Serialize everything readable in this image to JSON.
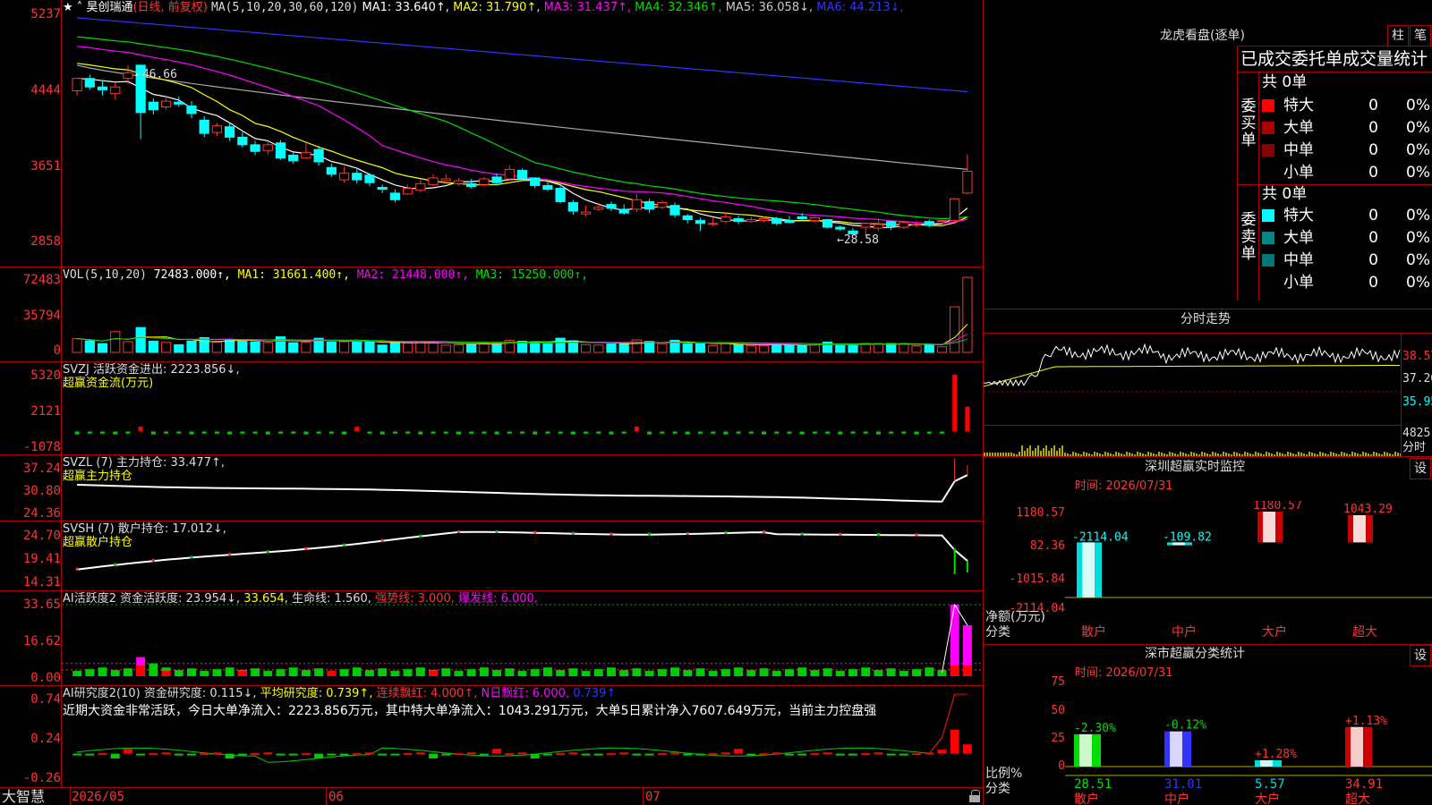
{
  "colors": {
    "up": "#ff3333",
    "down": "#00ffff",
    "bg": "#000000",
    "grid": "#aa0000",
    "white": "#ffffff",
    "yellow": "#ffff00",
    "magenta": "#ff00ff",
    "green": "#00dd00",
    "blue": "#3333ff",
    "gray": "#aaaaaa",
    "cyan": "#00ffff"
  },
  "main": {
    "stock_name": "昊创瑞通",
    "period_note": "(日线, 前复权)",
    "ma_title": "MA(5,10,20,30,60,120)",
    "ma_values": [
      {
        "label": "MA1: 33.640↑",
        "color": "#ffffff"
      },
      {
        "label": "MA2: 31.790↑",
        "color": "#ffff00"
      },
      {
        "label": "MA3: 31.437↑",
        "color": "#ff00ff"
      },
      {
        "label": "MA4: 32.346↑",
        "color": "#00dd00"
      },
      {
        "label": "MA5: 36.058↓",
        "color": "#cccccc"
      },
      {
        "label": "MA6: 44.213↓",
        "color": "#3333ff"
      }
    ],
    "y_ticks": [
      "5237",
      "4444",
      "3651",
      "2858"
    ],
    "high_label": "46.66",
    "low_label": "28.58"
  },
  "volume": {
    "title": "VOL(5,10,20)",
    "values": [
      {
        "label": "72483.000↑",
        "color": "#ffffff"
      },
      {
        "label": "MA1: 31661.400↑",
        "color": "#ffff00"
      },
      {
        "label": "MA2: 21448.000↑",
        "color": "#ff00ff"
      },
      {
        "label": "MA3: 15250.000↑",
        "color": "#00dd00"
      }
    ],
    "y_ticks": [
      "72483",
      "35794",
      "0"
    ]
  },
  "svzj": {
    "title": "SVZJ  活跃资金进出: 2223.856↓,",
    "subtitle": "超赢资金流(万元)",
    "y_ticks": [
      "5320",
      "2121",
      "-1078"
    ]
  },
  "svzl": {
    "title": "SVZL (7) 主力持仓: 33.477↑,",
    "subtitle": "超赢主力持仓",
    "y_ticks": [
      "37.24",
      "30.80",
      "24.36"
    ]
  },
  "svsh": {
    "title": "SVSH (7) 散户持仓: 17.012↓,",
    "subtitle": "超赢散户持仓",
    "y_ticks": [
      "24.70",
      "19.41",
      "14.31"
    ]
  },
  "ai_active": {
    "segments": [
      {
        "text": "AI活跃度2 资金活跃度: 23.954↓, ",
        "color": "#dddddd"
      },
      {
        "text": "33.654, ",
        "color": "#ffff00"
      },
      {
        "text": "生命线: 1.560, ",
        "color": "#dddddd"
      },
      {
        "text": "强势线: 3.000, ",
        "color": "#ff3333"
      },
      {
        "text": "爆发线: 6.000,",
        "color": "#ff00ff"
      }
    ],
    "y_ticks": [
      "33.65",
      "16.62",
      "0.00"
    ]
  },
  "ai_research": {
    "segments": [
      {
        "text": "AI研究度2(10) 资金研究度: 0.115↓, ",
        "color": "#dddddd"
      },
      {
        "text": "平均研究度: 0.739↑, ",
        "color": "#ffff00"
      },
      {
        "text": "连续飘红: 4.000↑, ",
        "color": "#ff3333"
      },
      {
        "text": "N日飘红: 6.000, ",
        "color": "#ff00ff"
      },
      {
        "text": "0.739↑",
        "color": "#3333ff"
      }
    ],
    "summary": "近期大资金非常活跃，今日大单净流入：2223.856万元，其中特大单净流入：1043.291万元，大单5日累计净入7607.649万元，当前主力控盘强",
    "y_ticks": [
      "0.74",
      "0.24",
      "-0.26"
    ]
  },
  "bottom": {
    "brand": "大智慧",
    "dates": [
      "2026/05",
      "06",
      "07"
    ]
  },
  "right": {
    "dragon_title": "龙虎看盘(逐单)",
    "btn_pillar": "柱",
    "btn_stroke": "笔",
    "stats_title": "已成交委托单成交量统计",
    "buy_side": "委买单",
    "sell_side": "委卖单",
    "buy_total": "共 0单",
    "sell_total": "共 0单",
    "buy_rows": [
      {
        "label": "特大",
        "count": "0",
        "pct": "0%",
        "color": "#ff0000"
      },
      {
        "label": "大单",
        "count": "0",
        "pct": "0%",
        "color": "#aa0000"
      },
      {
        "label": "中单",
        "count": "0",
        "pct": "0%",
        "color": "#880000"
      },
      {
        "label": "小单",
        "count": "0",
        "pct": "0%",
        "color": ""
      }
    ],
    "sell_rows": [
      {
        "label": "特大",
        "count": "0",
        "pct": "0%",
        "color": "#00ffff"
      },
      {
        "label": "大单",
        "count": "0",
        "pct": "0%",
        "color": "#008888"
      },
      {
        "label": "中单",
        "count": "0",
        "pct": "0%",
        "color": "#007777"
      },
      {
        "label": "小单",
        "count": "0",
        "pct": "0%",
        "color": ""
      }
    ],
    "intraday_title": "分时走势",
    "intraday_ticks": [
      "38.57",
      "37.26",
      "35.95",
      "4825",
      "分时"
    ],
    "sz_monitor_title": "深圳超赢实时监控",
    "btn_set": "设",
    "time_label": "时间: 2026/07/31",
    "monitor_ticks": [
      "1180.57",
      "82.36",
      "-1015.84",
      "-2114.04"
    ],
    "monitor_net": "净额(万元)",
    "monitor_cat": "分类",
    "monitor_cats": [
      "散户",
      "中户",
      "大户",
      "超大"
    ],
    "monitor_values": [
      "-2114.04",
      "-109.82",
      "1180.57",
      "1043.29"
    ],
    "class_title": "深市超赢分类统计",
    "class_ticks": [
      "75",
      "50",
      "25",
      "0"
    ],
    "class_ratio": "比例%",
    "class_cat": "分类",
    "class_changes": [
      "-2.30%",
      "-0.12%",
      "+1.28%",
      "+1.13%"
    ],
    "class_values": [
      "28.51",
      "31.01",
      "5.57",
      "34.91"
    ],
    "class_cats": [
      "散户",
      "中户",
      "大户",
      "超大"
    ]
  },
  "chart_data": [
    {
      "type": "candlestick",
      "title": "昊创瑞通 (日线, 前复权)",
      "x_start": "2026/05",
      "x_ticks": [
        "2026/05",
        "06",
        "07"
      ],
      "ylim": [
        2858,
        5237
      ],
      "annotations": [
        "46.66",
        "28.58"
      ],
      "candles": [
        [
          4430,
          4560,
          4560,
          4380,
          "u"
        ],
        [
          4560,
          4470,
          4600,
          4440,
          "d"
        ],
        [
          4470,
          4440,
          4540,
          4380,
          "d"
        ],
        [
          4400,
          4470,
          4520,
          4340,
          "u"
        ],
        [
          4560,
          4620,
          4700,
          4500,
          "u"
        ],
        [
          4700,
          4200,
          4700,
          3920,
          "d"
        ],
        [
          4310,
          4230,
          4350,
          4180,
          "d"
        ],
        [
          4260,
          4320,
          4370,
          4230,
          "u"
        ],
        [
          4310,
          4290,
          4370,
          4260,
          "d"
        ],
        [
          4270,
          4190,
          4320,
          4140,
          "d"
        ],
        [
          4120,
          3980,
          4160,
          3940,
          "d"
        ],
        [
          3990,
          4060,
          4090,
          3950,
          "u"
        ],
        [
          4050,
          3940,
          4090,
          3900,
          "d"
        ],
        [
          3940,
          3860,
          3990,
          3830,
          "d"
        ],
        [
          3860,
          3790,
          3900,
          3750,
          "d"
        ],
        [
          3800,
          3860,
          3890,
          3760,
          "u"
        ],
        [
          3880,
          3720,
          3910,
          3700,
          "d"
        ],
        [
          3750,
          3690,
          3780,
          3660,
          "d"
        ],
        [
          3720,
          3780,
          3880,
          3710,
          "u"
        ],
        [
          3810,
          3680,
          3850,
          3640,
          "d"
        ],
        [
          3620,
          3550,
          3660,
          3520,
          "d"
        ],
        [
          3490,
          3560,
          3630,
          3460,
          "u"
        ],
        [
          3560,
          3490,
          3600,
          3450,
          "d"
        ],
        [
          3540,
          3460,
          3560,
          3420,
          "d"
        ],
        [
          3410,
          3390,
          3440,
          3350,
          "d"
        ],
        [
          3350,
          3280,
          3390,
          3250,
          "d"
        ],
        [
          3340,
          3400,
          3440,
          3330,
          "u"
        ],
        [
          3380,
          3450,
          3500,
          3360,
          "u"
        ],
        [
          3440,
          3510,
          3550,
          3420,
          "u"
        ],
        [
          3480,
          3500,
          3550,
          3470,
          "u"
        ],
        [
          3450,
          3480,
          3510,
          3430,
          "u"
        ],
        [
          3450,
          3420,
          3500,
          3400,
          "d"
        ],
        [
          3440,
          3500,
          3520,
          3420,
          "u"
        ],
        [
          3520,
          3460,
          3560,
          3430,
          "d"
        ],
        [
          3500,
          3600,
          3640,
          3480,
          "u"
        ],
        [
          3590,
          3500,
          3610,
          3480,
          "d"
        ],
        [
          3510,
          3430,
          3520,
          3400,
          "d"
        ],
        [
          3430,
          3390,
          3470,
          3370,
          "d"
        ],
        [
          3400,
          3260,
          3420,
          3240,
          "d"
        ],
        [
          3250,
          3160,
          3280,
          3120,
          "d"
        ],
        [
          3130,
          3150,
          3220,
          3100,
          "u"
        ],
        [
          3180,
          3200,
          3250,
          3160,
          "u"
        ],
        [
          3230,
          3190,
          3260,
          3160,
          "d"
        ],
        [
          3180,
          3140,
          3230,
          3120,
          "d"
        ],
        [
          3180,
          3280,
          3340,
          3150,
          "u"
        ],
        [
          3260,
          3180,
          3290,
          3140,
          "d"
        ],
        [
          3200,
          3250,
          3270,
          3180,
          "u"
        ],
        [
          3220,
          3120,
          3250,
          3090,
          "d"
        ],
        [
          3110,
          3070,
          3130,
          3030,
          "d"
        ],
        [
          3060,
          3030,
          3090,
          2950,
          "d"
        ],
        [
          3020,
          3030,
          3090,
          3000,
          "u"
        ],
        [
          3050,
          3100,
          3140,
          3030,
          "u"
        ],
        [
          3080,
          3050,
          3110,
          3020,
          "d"
        ],
        [
          3050,
          3070,
          3100,
          3040,
          "u"
        ],
        [
          3060,
          3080,
          3100,
          3040,
          "u"
        ],
        [
          3080,
          3030,
          3100,
          3010,
          "d"
        ],
        [
          3060,
          3040,
          3110,
          3030,
          "d"
        ],
        [
          3100,
          3080,
          3140,
          3060,
          "d"
        ],
        [
          3060,
          3090,
          3100,
          3040,
          "u"
        ],
        [
          3070,
          2990,
          3080,
          2980,
          "d"
        ],
        [
          2990,
          2970,
          3010,
          2950,
          "d"
        ],
        [
          2950,
          2920,
          2980,
          2900,
          "d"
        ],
        [
          2990,
          3030,
          3040,
          2900,
          "u"
        ],
        [
          2980,
          3020,
          3080,
          2950,
          "u"
        ],
        [
          3050,
          3000,
          3060,
          2960,
          "d"
        ],
        [
          2990,
          3040,
          3060,
          2970,
          "u"
        ],
        [
          3010,
          3020,
          3060,
          2990,
          "u"
        ],
        [
          3050,
          3010,
          3070,
          2990,
          "d"
        ],
        [
          3060,
          3060,
          3070,
          3040,
          "u"
        ],
        [
          3060,
          3290,
          3300,
          3050,
          "u"
        ],
        [
          3350,
          3580,
          3760,
          3340,
          "u"
        ]
      ]
    },
    {
      "type": "bar",
      "title": "VOL(5,10,20)",
      "ylim": [
        0,
        72483
      ],
      "values": [
        72483
      ],
      "series": [
        {
          "name": "MA1",
          "values": [
            31661.4
          ]
        },
        {
          "name": "MA2",
          "values": [
            21448.0
          ]
        },
        {
          "name": "MA3",
          "values": [
            15250.0
          ]
        }
      ]
    },
    {
      "type": "bar",
      "title": "SVZJ 活跃资金进出",
      "ylim": [
        -1078,
        5320
      ],
      "values": [
        2223.856
      ]
    },
    {
      "type": "line",
      "title": "SVZL (7) 主力持仓",
      "ylim": [
        24.36,
        37.24
      ],
      "values": [
        33.477
      ]
    },
    {
      "type": "line",
      "title": "SVSH (7) 散户持仓",
      "ylim": [
        14.31,
        24.7
      ],
      "values": [
        17.012
      ]
    },
    {
      "type": "bar",
      "title": "AI活跃度2 资金活跃度",
      "ylim": [
        0,
        33.65
      ],
      "values": [
        23.954
      ]
    },
    {
      "type": "bar",
      "title": "AI研究度2(10) 资金研究度",
      "ylim": [
        -0.26,
        0.74
      ],
      "values": [
        0.115
      ]
    },
    {
      "type": "bar",
      "title": "深圳超赢实时监控",
      "categories": [
        "散户",
        "中户",
        "大户",
        "超大"
      ],
      "values": [
        -2114.04,
        -109.82,
        1180.57,
        1043.29
      ],
      "ylabel": "净额(万元)",
      "ylim": [
        -2114.04,
        1180.57
      ]
    },
    {
      "type": "bar",
      "title": "深市超赢分类统计",
      "categories": [
        "散户",
        "中户",
        "大户",
        "超大"
      ],
      "values": [
        28.51,
        31.01,
        5.57,
        34.91
      ],
      "changes": [
        "-2.30%",
        "-0.12%",
        "+1.28%",
        "+1.13%"
      ],
      "ylabel": "比例%",
      "ylim": [
        0,
        75
      ]
    }
  ]
}
